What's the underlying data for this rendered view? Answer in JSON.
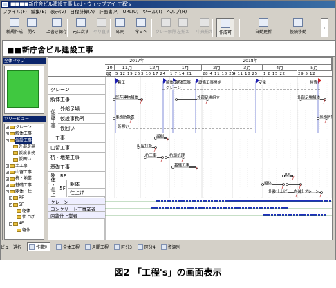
{
  "window": {
    "title": "■■■■新庁舎ビル建設工事.kzd - ウェッブアイ 工程's",
    "menu": [
      "ファイル(F)",
      "編集(E)",
      "表示(V)",
      "日程計算(A)",
      "計画書(P)",
      "URL(U)",
      "ツール(T)",
      "ヘルプ(H)"
    ]
  },
  "toolbar": {
    "buttons": [
      {
        "label": "新規作成",
        "icon": "new-file-icon",
        "enabled": true
      },
      {
        "label": "開く",
        "icon": "folder-open-icon",
        "enabled": true
      },
      {
        "label": "上書き保存",
        "icon": "save-icon",
        "enabled": true
      },
      {
        "label": "元に戻す",
        "icon": "undo-icon",
        "enabled": true
      },
      {
        "label": "やり直す",
        "icon": "redo-icon",
        "enabled": false
      },
      {
        "label": "印刷",
        "icon": "printer-icon",
        "enabled": true
      },
      {
        "label": "今日へ",
        "icon": "calendar-today-icon",
        "enabled": true
      },
      {
        "label": "クレー解除",
        "icon": "grid-icon",
        "enabled": false
      },
      {
        "label": "左揃え",
        "icon": "align-left-icon",
        "enabled": false
      },
      {
        "label": "中央揃え",
        "icon": "align-center-icon",
        "enabled": false
      },
      {
        "label": "作成可",
        "icon": "edit-icon",
        "enabled": true
      },
      {
        "label": "自動更新",
        "icon": "auto-update-icon",
        "enabled": true
      },
      {
        "label": "後続移動",
        "icon": "move-successor-icon",
        "enabled": true
      }
    ]
  },
  "project": {
    "title": "■■新庁舎ビル建設工事"
  },
  "panes": {
    "map_title": "全体マップ",
    "tree_title": "ツリービュー"
  },
  "tree": [
    {
      "label": "クレーン",
      "level": 0,
      "exp": "+",
      "sel": false
    },
    {
      "label": "解体工事",
      "level": 0,
      "exp": "+",
      "sel": false
    },
    {
      "label": "仮設工事",
      "level": 0,
      "exp": "-",
      "sel": true
    },
    {
      "label": "外部足場",
      "level": 1,
      "exp": "",
      "sel": false
    },
    {
      "label": "仮設事務",
      "level": 1,
      "exp": "",
      "sel": false
    },
    {
      "label": "仮囲い",
      "level": 1,
      "exp": "",
      "sel": false
    },
    {
      "label": "土工事",
      "level": 0,
      "exp": "+",
      "sel": false
    },
    {
      "label": "山留工事",
      "level": 0,
      "exp": "+",
      "sel": false
    },
    {
      "label": "杭・地業",
      "level": 0,
      "exp": "+",
      "sel": false
    },
    {
      "label": "基礎工事",
      "level": 0,
      "exp": "+",
      "sel": false
    },
    {
      "label": "躯体・仕",
      "level": 0,
      "exp": "-",
      "sel": false
    },
    {
      "label": "RF",
      "level": 1,
      "exp": "+",
      "sel": false
    },
    {
      "label": "5F",
      "level": 1,
      "exp": "-",
      "sel": false
    },
    {
      "label": "躯体",
      "level": 2,
      "exp": "",
      "sel": false
    },
    {
      "label": "仕上げ",
      "level": 2,
      "exp": "",
      "sel": false
    },
    {
      "label": "4F",
      "level": 1,
      "exp": "-",
      "sel": false
    },
    {
      "label": "躯体",
      "level": 2,
      "exp": "",
      "sel": false
    }
  ],
  "timeline": {
    "years": [
      "2017年",
      "2018年"
    ],
    "months": [
      "10月",
      "11月",
      "12月",
      "1月",
      "2月",
      "3月",
      "4月",
      "5月"
    ],
    "days": [
      "22",
      "5 12 19 26",
      "3 10 17 24",
      "1  7 14 21",
      "28 4 11 18 25",
      "4 11 18 25",
      "1 8 15 22",
      "29 5 12"
    ]
  },
  "rows": [
    {
      "label": "",
      "events": [
        "着工",
        "解体工事開始",
        "躯体工事",
        "設備工事開始",
        "受電",
        "検査"
      ]
    },
    {
      "label": "クレーン",
      "events": [
        "クレーン"
      ]
    },
    {
      "label": "解体工事",
      "events": [
        "既存建物解体",
        "外部足場組立",
        "外部足場解体"
      ]
    },
    {
      "label": "外部足場",
      "events": []
    },
    {
      "label": "仮設事務所",
      "events": [
        "事務所設置",
        "事務所撤去"
      ]
    },
    {
      "label": "仮囲い",
      "events": [
        "仮囲い"
      ]
    },
    {
      "label": "土工事",
      "events": [
        "掘削"
      ]
    },
    {
      "label": "山留工事",
      "events": [
        "山留打設"
      ]
    },
    {
      "label": "杭・地業工事",
      "events": [
        "杭工事",
        "杭頭処理"
      ]
    },
    {
      "label": "基礎工事",
      "events": [
        "基礎工事"
      ]
    },
    {
      "label": "RF",
      "events": [
        "RF"
      ]
    },
    {
      "label": "躯体",
      "events": [
        "躯体"
      ]
    },
    {
      "label": "仕上げ",
      "events": [
        "外装仕上げ",
        "内装仕上",
        "クレーン"
      ]
    }
  ],
  "row_groups": {
    "kasetsu": "仮設工事",
    "kutai": "躯体・仕上げ",
    "floor": "5F"
  },
  "resources": [
    "クレーン",
    "コンクリート工事業者",
    "内装仕上業者"
  ],
  "statusbar": {
    "items": [
      {
        "label": "ビュー選択",
        "icon": "",
        "active": false
      },
      {
        "label": "作業別",
        "icon": "tasks-icon",
        "active": true
      },
      {
        "label": "全体工程",
        "icon": "overall-schedule-icon",
        "active": false
      },
      {
        "label": "月間工程",
        "icon": "monthly-schedule-icon",
        "active": false
      },
      {
        "label": "区分3",
        "icon": "category-icon",
        "active": false
      },
      {
        "label": "区分4",
        "icon": "category-icon",
        "active": false
      },
      {
        "label": "資源別",
        "icon": "resource-icon",
        "active": false
      }
    ]
  },
  "caption": "図2 「工程's」の画面表示"
}
